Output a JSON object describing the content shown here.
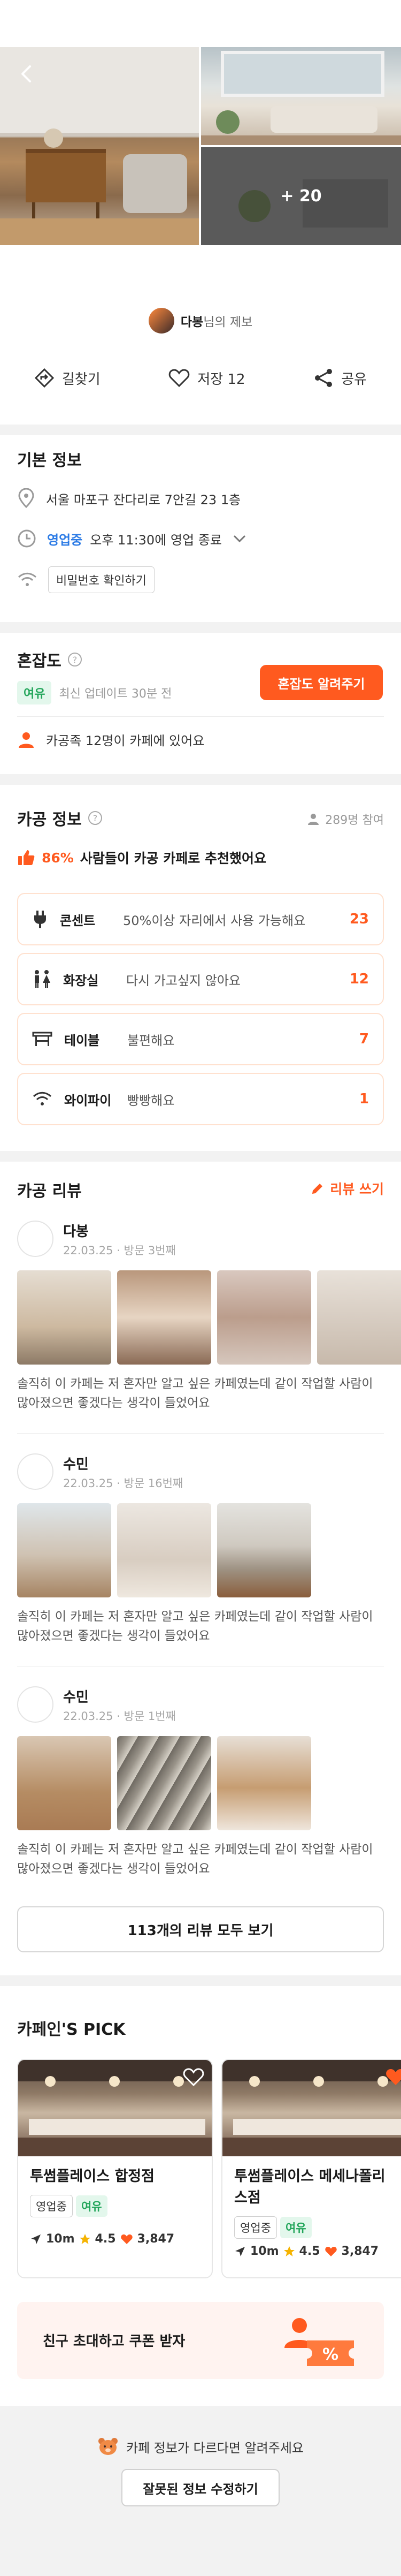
{
  "hero": {
    "more_photos": "+ 20"
  },
  "reporter": {
    "name": "다봉",
    "suffix": "님의 제보"
  },
  "actions": {
    "directions": "길찾기",
    "save": "저장 12",
    "share": "공유"
  },
  "basic_info": {
    "title": "기본 정보",
    "address": "서울 마포구 잔다리로 7안길 23 1층",
    "status": "영업중",
    "hours": "오후 11:30에 영업 종료",
    "wifi_button": "비밀번호 확인하기"
  },
  "congestion": {
    "title": "혼잡도",
    "level": "여유",
    "updated": "최신 업데이트 30분 전",
    "report_button": "혼잡도 알려주기",
    "people": "카공족 12명이 카페에 있어요"
  },
  "kagong_info": {
    "title": "카공 정보",
    "participants": "289명 참여",
    "recommend_pct": "86%",
    "recommend_text": "사람들이 카공 카페로 추천했어요",
    "stats": [
      {
        "name": "콘센트",
        "desc": "50%이상 자리에서 사용 가능해요",
        "count": "23"
      },
      {
        "name": "화장실",
        "desc": "다시 가고싶지 않아요",
        "count": "12"
      },
      {
        "name": "테이블",
        "desc": "불편해요",
        "count": "7"
      },
      {
        "name": "와이파이",
        "desc": "빵빵해요",
        "count": "1"
      }
    ]
  },
  "reviews": {
    "title": "카공 리뷰",
    "write": "리뷰 쓰기",
    "items": [
      {
        "name": "다봉",
        "meta": "22.03.25 · 방문 3번째",
        "text": "솔직히 이 카페는 저 혼자만 알고 싶은 카페였는데 같이 작업할 사람이 많아졌으면 좋겠다는 생각이 들었어요"
      },
      {
        "name": "수민",
        "meta": "22.03.25 · 방문 16번째",
        "text": "솔직히 이 카페는 저 혼자만 알고 싶은 카페였는데 같이 작업할 사람이 많아졌으면 좋겠다는 생각이 들었어요"
      },
      {
        "name": "수민",
        "meta": "22.03.25 · 방문 1번째",
        "text": "솔직히 이 카페는 저 혼자만 알고 싶은 카페였는데 같이 작업할 사람이 많아졌으면 좋겠다는 생각이 들었어요"
      }
    ],
    "all_button": "113개의 리뷰 모두 보기"
  },
  "pick": {
    "title": "카페인'S PICK",
    "cards": [
      {
        "name": "투썸플레이스 합정점",
        "tags": [
          "영업중",
          "여유"
        ],
        "distance": "10m",
        "rating": "4.5",
        "likes": "3,847"
      },
      {
        "name": "투썸플레이스 메세나폴리스점",
        "tags": [
          "영업중",
          "여유"
        ],
        "distance": "10m",
        "rating": "4.5",
        "likes": "3,847"
      }
    ]
  },
  "invite": {
    "text": "친구 초대하고 쿠폰 받자"
  },
  "footer": {
    "note": "카페 정보가 다르다면 알려주세요",
    "fix_button": "잘못된 정보 수정하기"
  },
  "colors": {
    "accent": "#ff5a1f",
    "open_blue": "#2c7be5",
    "green": "#22a55a"
  }
}
